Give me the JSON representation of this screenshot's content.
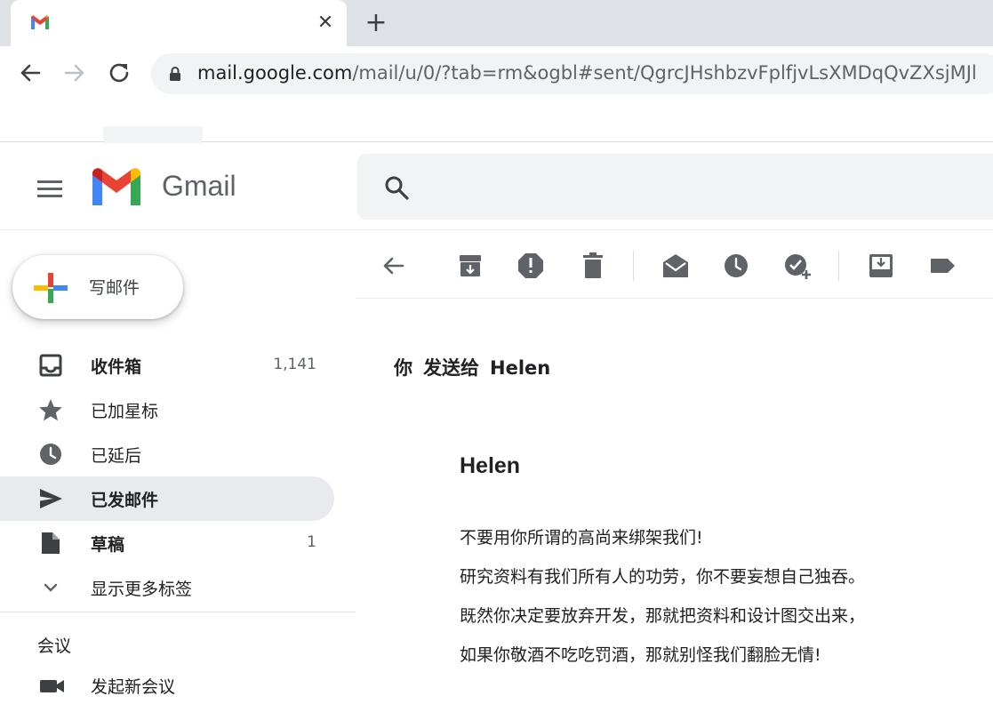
{
  "browser": {
    "tab": {
      "close_glyph": "✕"
    },
    "new_tab_glyph": "+",
    "url_host": "mail.google.com",
    "url_path": "/mail/u/0/?tab=rm&ogbl#sent/QgrcJHshbzvFplfjvLsXMDqQvZXsjMJl"
  },
  "header": {
    "app_name": "Gmail"
  },
  "sidebar": {
    "compose_label": "写邮件",
    "items": [
      {
        "label": "收件箱",
        "count": "1,141",
        "icon": "inbox-icon",
        "bold": true
      },
      {
        "label": "已加星标",
        "count": "",
        "icon": "star-icon"
      },
      {
        "label": "已延后",
        "count": "",
        "icon": "clock-icon"
      },
      {
        "label": "已发邮件",
        "count": "",
        "icon": "send-icon",
        "active": true,
        "bold": true
      },
      {
        "label": "草稿",
        "count": "1",
        "icon": "draft-icon",
        "bold": true
      },
      {
        "label": "显示更多标签",
        "count": "",
        "icon": "chevron-down-icon"
      }
    ],
    "meet": {
      "title": "会议",
      "new_meeting": "发起新会议"
    }
  },
  "email": {
    "sender_parts": [
      "你",
      "发送给",
      "Helen"
    ],
    "greeting": "Helen",
    "body": [
      "不要用你所谓的高尚来绑架我们!",
      "研究资料有我们所有人的功劳，你不要妄想自己独吞。",
      "既然你决定要放弃开发，那就把资料和设计图交出来，",
      "如果你敬酒不吃吃罚酒，那就别怪我们翻脸无情!"
    ]
  },
  "colors": {
    "gmail_red": "#ea4335",
    "gmail_blue": "#4285f4",
    "gmail_green": "#34a853",
    "gmail_yellow": "#fbbc04",
    "active_bg": "#e8eaed",
    "icon_gray": "#5f6368"
  }
}
